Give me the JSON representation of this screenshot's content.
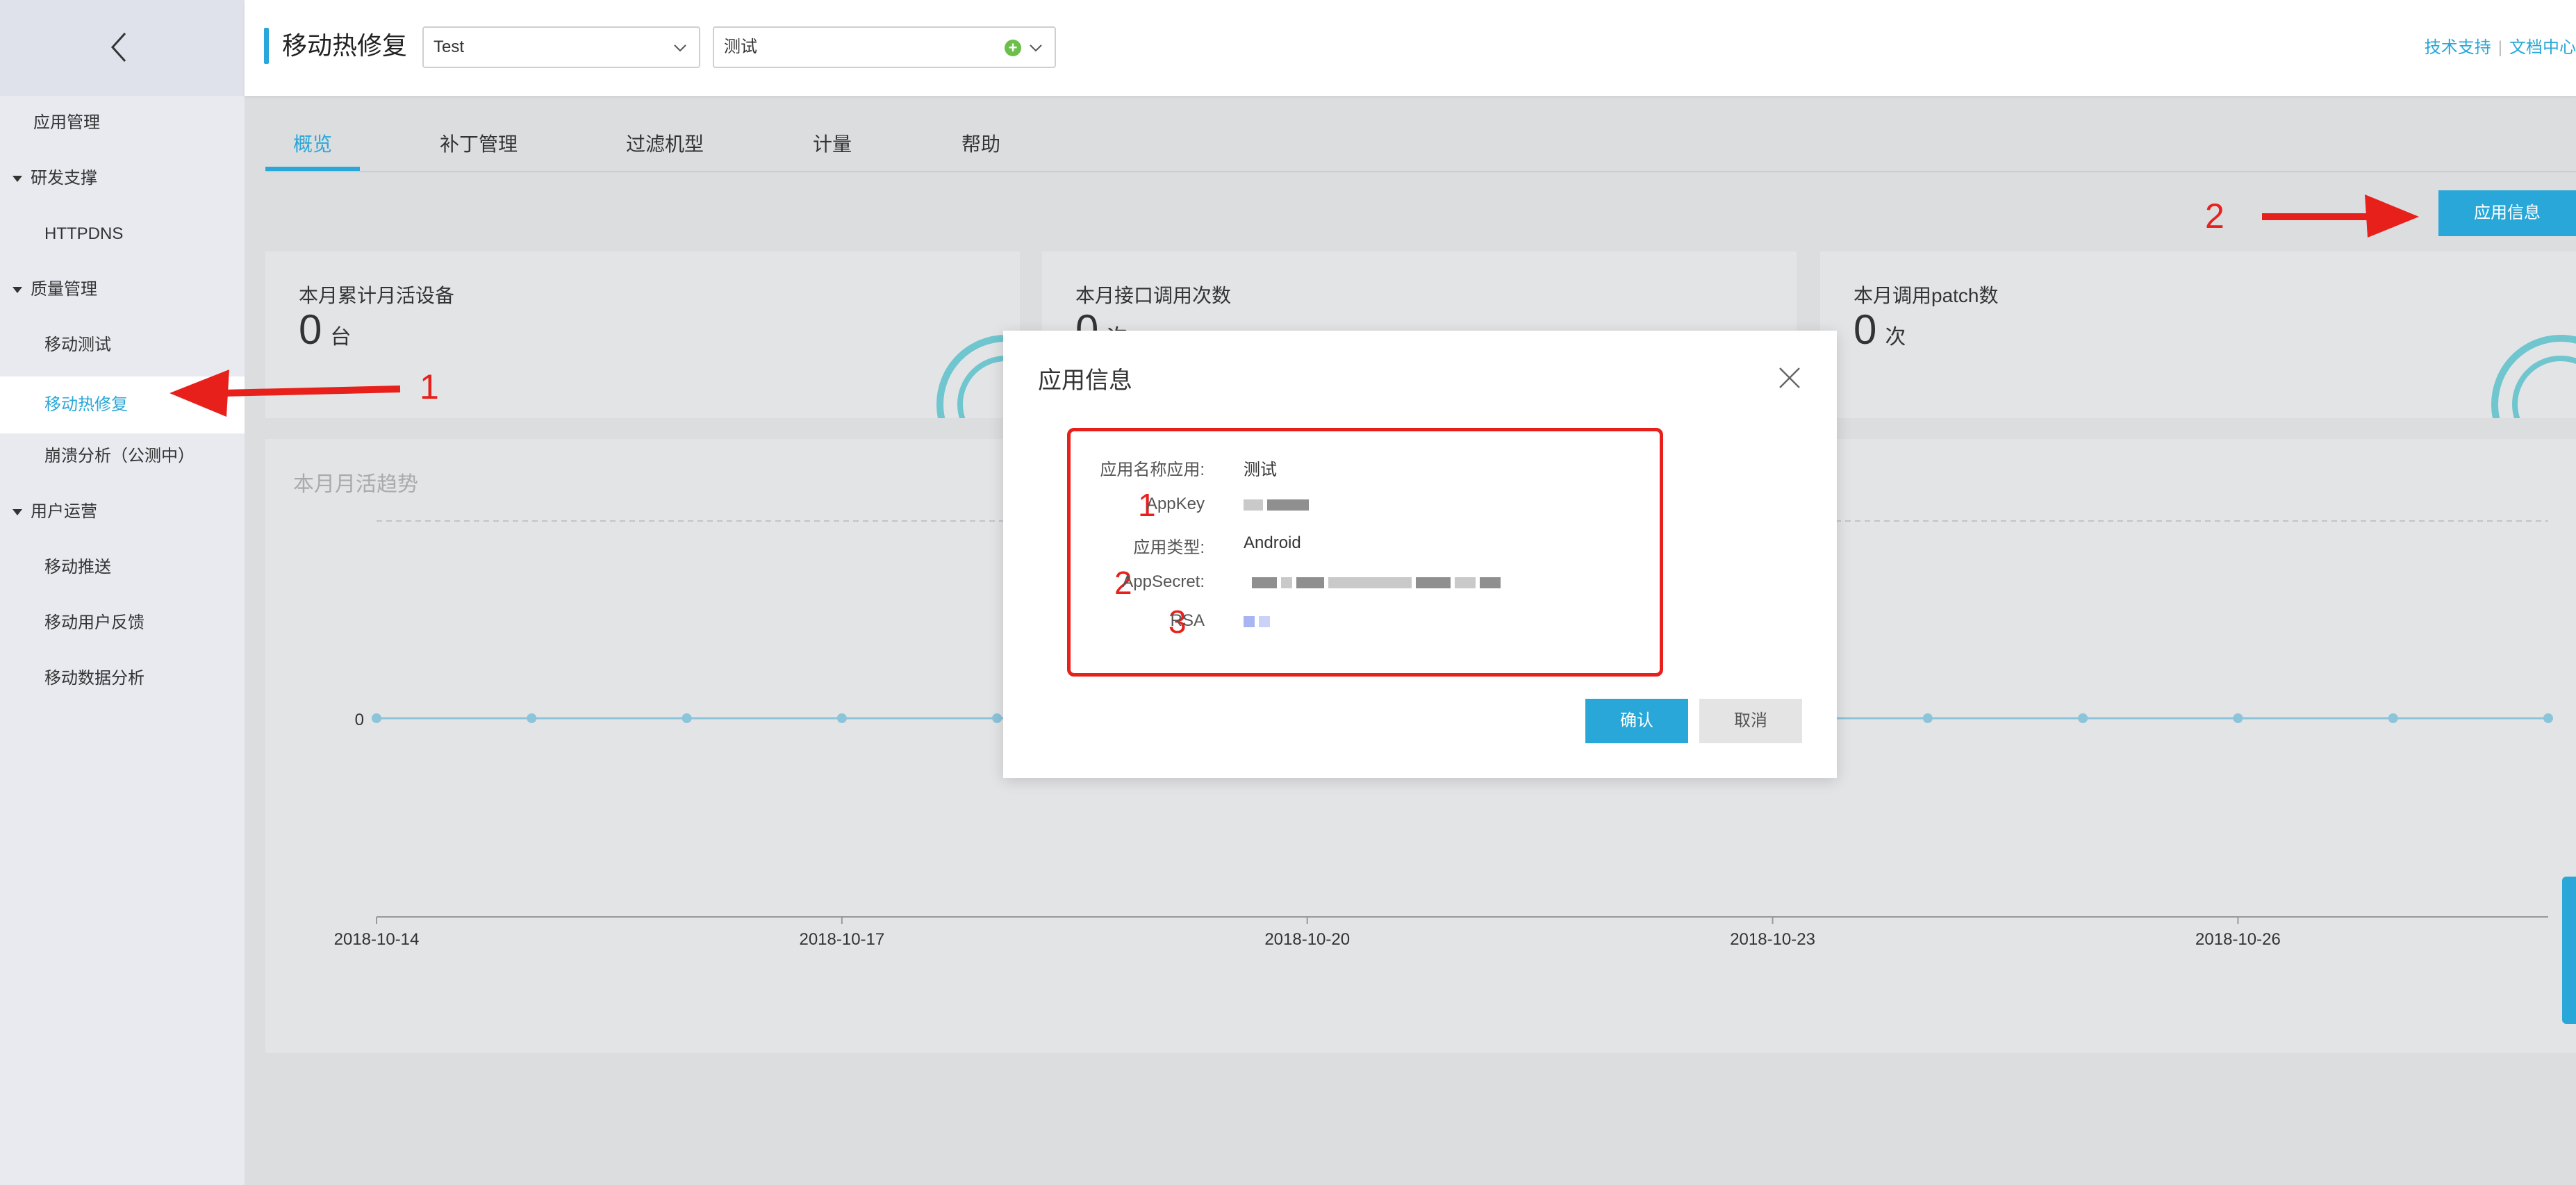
{
  "sidebar": {
    "items": [
      {
        "label": "应用管理",
        "type": "l1"
      },
      {
        "label": "研发支撑",
        "type": "group"
      },
      {
        "label": "HTTPDNS",
        "type": "l2"
      },
      {
        "label": "质量管理",
        "type": "group"
      },
      {
        "label": "移动测试",
        "type": "l2"
      },
      {
        "label": "移动热修复",
        "type": "l2",
        "active": true
      },
      {
        "label": "崩溃分析（公测中）",
        "type": "l2"
      },
      {
        "label": "用户运营",
        "type": "group"
      },
      {
        "label": "移动推送",
        "type": "l2"
      },
      {
        "label": "移动用户反馈",
        "type": "l2"
      },
      {
        "label": "移动数据分析",
        "type": "l2"
      }
    ]
  },
  "header": {
    "title": "移动热修复",
    "select_app": "Test",
    "select_project": "测试",
    "links": [
      "技术支持",
      "文档中心"
    ]
  },
  "tabs": [
    "概览",
    "补丁管理",
    "过滤机型",
    "计量",
    "帮助"
  ],
  "app_info_button": "应用信息",
  "cards": [
    {
      "title": "本月累计月活设备",
      "value": "0",
      "unit": "台"
    },
    {
      "title": "本月接口调用次数",
      "value": "0",
      "unit": "次"
    },
    {
      "title": "本月调用patch数",
      "value": "0",
      "unit": "次"
    }
  ],
  "chart_data": {
    "type": "line",
    "title": "本月月活趋势",
    "x": [
      "2018-10-14",
      "2018-10-17",
      "2018-10-20",
      "2018-10-23",
      "2018-10-26"
    ],
    "yticks": [
      "0"
    ],
    "series": [
      {
        "values": [
          0,
          0,
          0,
          0,
          0,
          0,
          0,
          0,
          0,
          0,
          0,
          0,
          0,
          0,
          0
        ]
      }
    ],
    "grid": true,
    "color": "#8cc4da"
  },
  "dialog": {
    "title": "应用信息",
    "app_name_label": "应用名称应用:",
    "app_name_value": "测试",
    "appkey_label": "AppKey",
    "app_type_label": "应用类型:",
    "app_type_value": "Android",
    "appsecret_label": "AppSecret:",
    "rsa_label": "RSA",
    "confirm": "确认",
    "cancel": "取消"
  },
  "annotations": {
    "dialog_numbers": [
      "1",
      "2",
      "3"
    ],
    "sidebar_arrow_number": "1",
    "button_arrow_number": "2"
  },
  "colors": {
    "accent": "#29a7d8",
    "annotation_red": "#e8201c"
  }
}
